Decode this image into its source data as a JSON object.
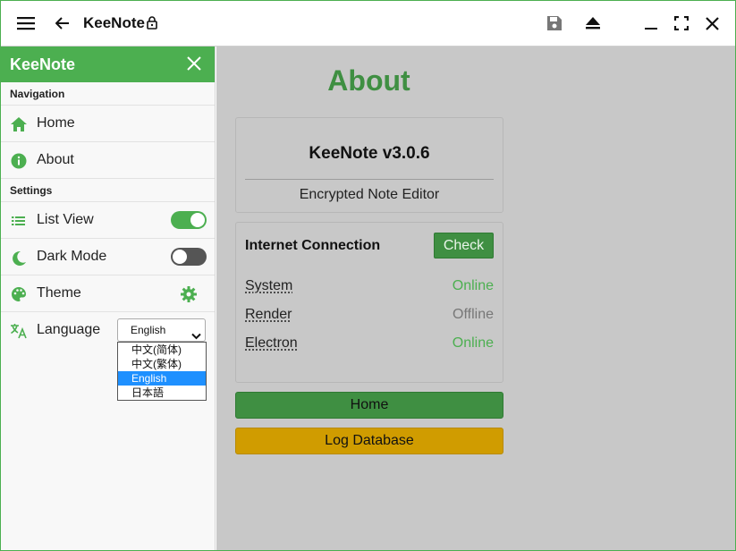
{
  "window": {
    "app_title": "KeeNote"
  },
  "sidebar": {
    "title": "KeeNote",
    "nav_section": "Navigation",
    "settings_section": "Settings",
    "nav_items": [
      {
        "label": "Home",
        "icon": "home-icon"
      },
      {
        "label": "About",
        "icon": "info-icon"
      }
    ],
    "settings": {
      "list_view": {
        "label": "List View",
        "enabled": true
      },
      "dark_mode": {
        "label": "Dark Mode",
        "enabled": false
      },
      "theme": {
        "label": "Theme"
      },
      "language": {
        "label": "Language",
        "selected": "English",
        "options": [
          "中文(简体)",
          "中文(繁体)",
          "English",
          "日本語"
        ]
      }
    }
  },
  "main": {
    "heading": "About",
    "version_title": "KeeNote v3.0.6",
    "subtitle": "Encrypted Note Editor",
    "internet": {
      "title": "Internet Connection",
      "check_label": "Check",
      "rows": [
        {
          "name": "System",
          "status": "Online"
        },
        {
          "name": "Render",
          "status": "Offline"
        },
        {
          "name": "Electron",
          "status": "Online"
        }
      ]
    },
    "home_button": "Home",
    "log_button": "Log Database"
  },
  "colors": {
    "accent": "#4caf50",
    "accent_dark": "#3f8f42",
    "warning": "#d09c00",
    "panel_bg": "#c8c8c8"
  }
}
